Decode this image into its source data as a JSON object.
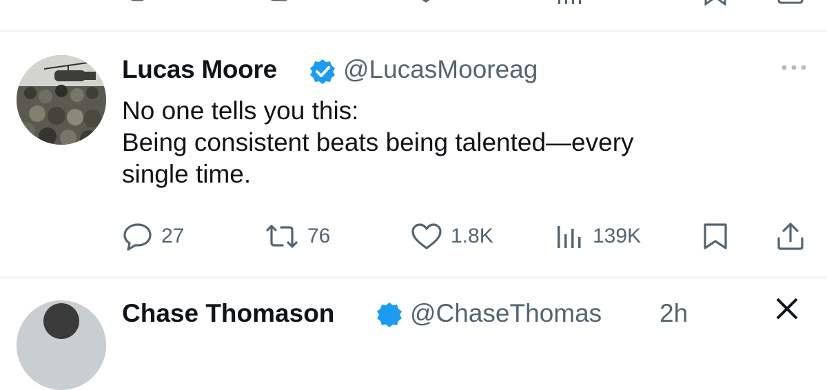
{
  "main_tweet": {
    "author_name": "Lucas Moore",
    "handle": "@LucasMooreag",
    "verified": true,
    "text_lines": [
      "No one tells you this:",
      "Being consistent beats being talented—every",
      "single time."
    ],
    "actions": {
      "replies": "27",
      "reposts": "76",
      "likes": "1.8K",
      "views": "139K"
    },
    "icons": {
      "reply": "reply-icon",
      "repost": "repost-icon",
      "like": "like-icon",
      "views": "views-icon",
      "bookmark": "bookmark-icon",
      "share": "share-icon",
      "more": "more-options-icon",
      "badge": "verified-badge-icon"
    }
  },
  "next_tweet": {
    "author_name": "Chase Thomason",
    "handle": "@ChaseThomas",
    "time": "2h"
  },
  "colors": {
    "text": "#0f1419",
    "secondary": "#536471",
    "verified": "#1d9bf0",
    "divider": "#eff3f4"
  }
}
